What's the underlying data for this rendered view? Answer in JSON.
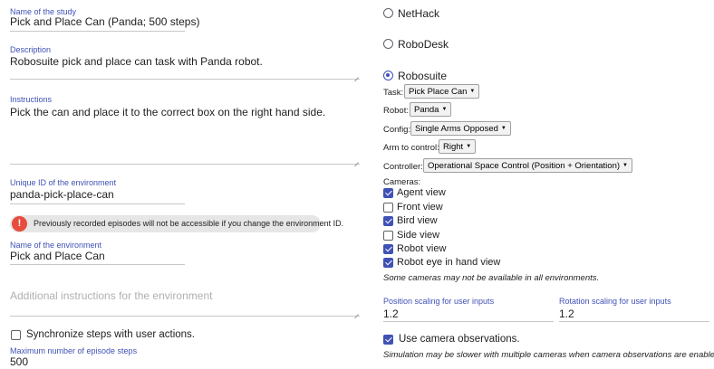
{
  "study": {
    "name_label": "Name of the study",
    "name_value": "Pick and Place Can (Panda; 500 steps)",
    "description_label": "Description",
    "description_value": "Robosuite pick and place can task with Panda robot.",
    "instructions_label": "Instructions",
    "instructions_value": "Pick the can and place it to the correct box on the right hand side."
  },
  "environment": {
    "id_label": "Unique ID of the environment",
    "id_value": "panda-pick-place-can",
    "warning_icon": "!",
    "warning_text": "Previously recorded episodes will not be accessible if you change the environment ID.",
    "name_label": "Name of the environment",
    "name_value": "Pick and Place Can",
    "additional_placeholder": "Additional instructions for the environment",
    "sync_label": "Synchronize steps with user actions.",
    "sync_checked": false,
    "max_steps_label": "Maximum number of episode steps",
    "max_steps_value": "500"
  },
  "env_types": {
    "nethack": {
      "label": "NetHack",
      "selected": false
    },
    "robodesk": {
      "label": "RoboDesk",
      "selected": false
    },
    "robosuite": {
      "label": "Robosuite",
      "selected": true
    }
  },
  "robosuite": {
    "task_label": "Task:",
    "task_value": "Pick Place Can",
    "robot_label": "Robot:",
    "robot_value": "Panda",
    "config_label": "Config:",
    "config_value": "Single Arms Opposed",
    "arm_label": "Arm to control:",
    "arm_value": "Right",
    "controller_label": "Controller:",
    "controller_value": "Operational Space Control (Position + Orientation)",
    "cameras_label": "Cameras:",
    "cameras": [
      {
        "label": "Agent view",
        "checked": true
      },
      {
        "label": "Front view",
        "checked": false
      },
      {
        "label": "Bird view",
        "checked": true
      },
      {
        "label": "Side view",
        "checked": false
      },
      {
        "label": "Robot view",
        "checked": true
      },
      {
        "label": "Robot eye in hand view",
        "checked": true
      }
    ],
    "cameras_note": "Some cameras may not be available in all environments.",
    "position_scaling_label": "Position scaling for user inputs",
    "position_scaling_value": "1.2",
    "rotation_scaling_label": "Rotation scaling for user inputs",
    "rotation_scaling_value": "1.2",
    "camera_obs_label": "Use camera observations.",
    "camera_obs_checked": true,
    "camera_obs_note": "Simulation may be slower with multiple cameras when camera observations are enabled."
  },
  "colors": {
    "accent": "#3f51b5",
    "warning": "#e74c3c",
    "warning_bg": "#e6e6e6"
  }
}
